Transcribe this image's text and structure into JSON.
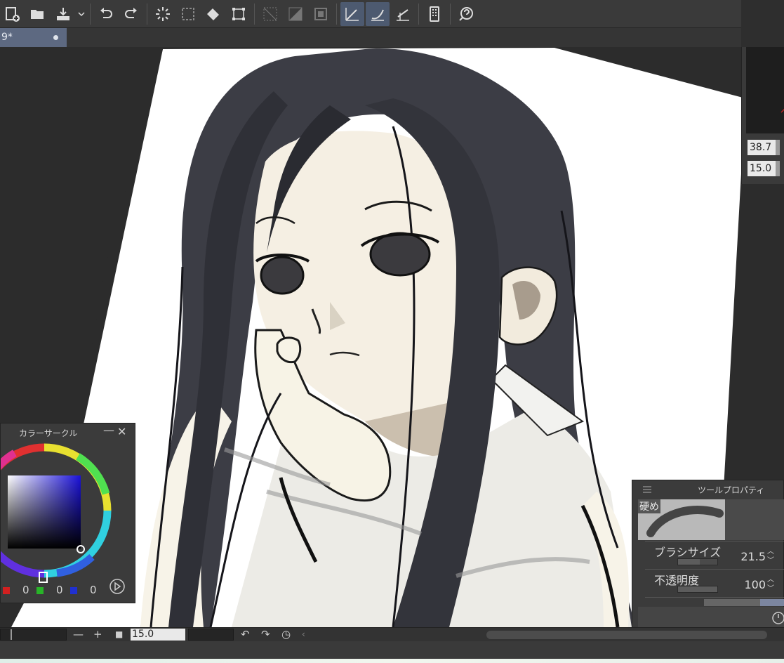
{
  "document": {
    "tab_label": "9*"
  },
  "toolbar": {
    "buttons": [
      "new-file-icon",
      "open-folder-icon",
      "save-icon",
      "chevron-down-icon",
      "undo-icon",
      "redo-icon",
      "marching-ants-icon",
      "selection-icon",
      "fill-icon",
      "transform-icon",
      "clear-icon",
      "clear-outside-icon",
      "crop-icon",
      "ruler-icon",
      "brush-ruler-icon",
      "perspective-icon",
      "tablet-icon",
      "help-icon"
    ]
  },
  "navigator": {
    "zoom_value": "38.7",
    "angle_value": "15.0"
  },
  "color_circle": {
    "title": "カラーサークル",
    "r_value": "0",
    "g_value": "0",
    "b_value": "0",
    "colors": {
      "r": "#d22020",
      "g": "#28b428",
      "b": "#2030d0",
      "main": "#1a11d9"
    }
  },
  "tool_property": {
    "title": "ツールプロパティ",
    "preset_label": "硬め",
    "brush_size_label": "ブラシサイズ",
    "brush_size_value": "21.5",
    "opacity_label": "不透明度",
    "opacity_value": "100",
    "brush_size_fill": 0.55,
    "opacity_fill": 1.0
  },
  "statusbar": {
    "zoom_value": "15.0"
  }
}
